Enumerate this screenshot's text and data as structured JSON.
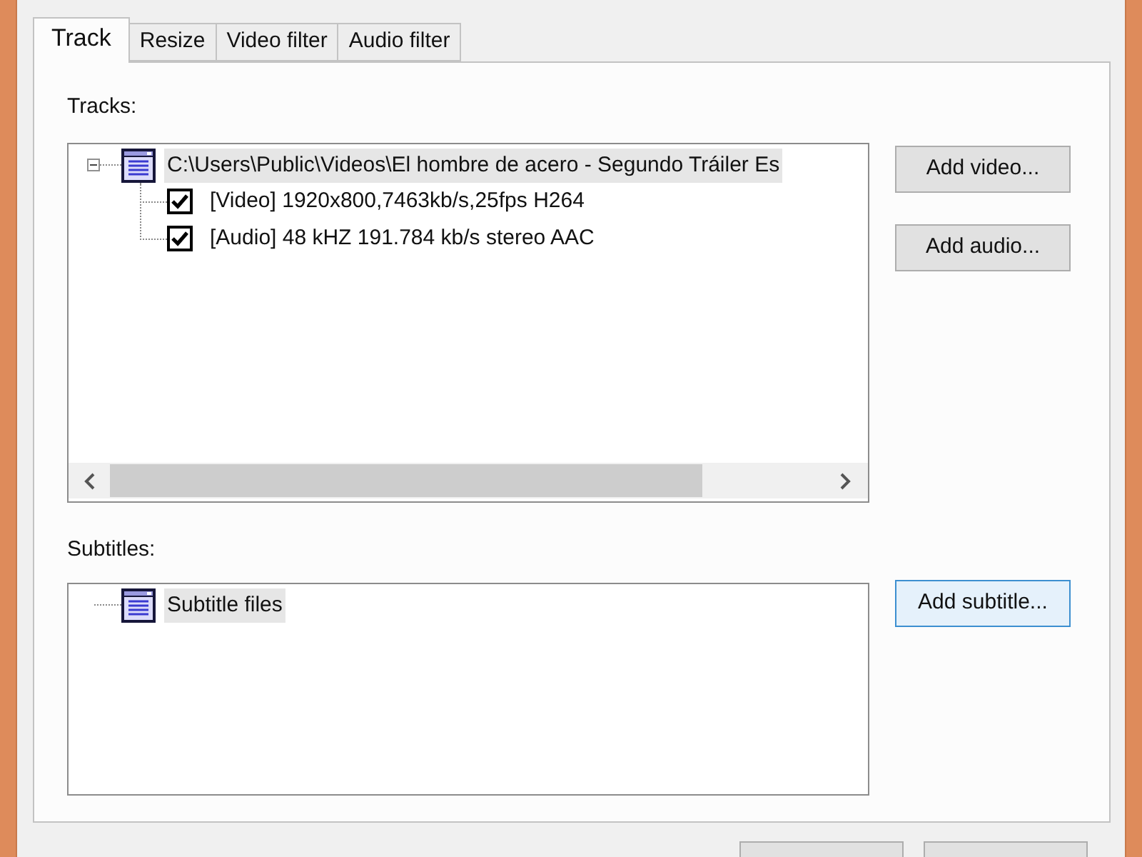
{
  "tabs": [
    {
      "label": "Track",
      "selected": true
    },
    {
      "label": "Resize",
      "selected": false
    },
    {
      "label": "Video filter",
      "selected": false
    },
    {
      "label": "Audio filter",
      "selected": false
    }
  ],
  "tracks": {
    "label": "Tracks:",
    "tree": [
      {
        "label": "C:\\Users\\Public\\Videos\\El hombre de acero - Segundo Tráiler Es",
        "selected": true,
        "expanded": true,
        "children": [
          {
            "label": "[Video] 1920x800,7463kb/s,25fps H264",
            "selected": false,
            "checked": true
          },
          {
            "label": "[Audio] 48 kHZ 191.784 kb/s stereo AAC",
            "selected": false,
            "checked": true
          }
        ]
      }
    ],
    "buttons": [
      {
        "label": "Add video...",
        "focused": false
      },
      {
        "label": "Add audio...",
        "focused": false
      }
    ]
  },
  "subtitles": {
    "label": "Subtitles:",
    "tree": [
      {
        "label": "Subtitle files",
        "selected": true
      }
    ],
    "buttons": [
      {
        "label": "Add subtitle...",
        "focused": true
      }
    ]
  }
}
